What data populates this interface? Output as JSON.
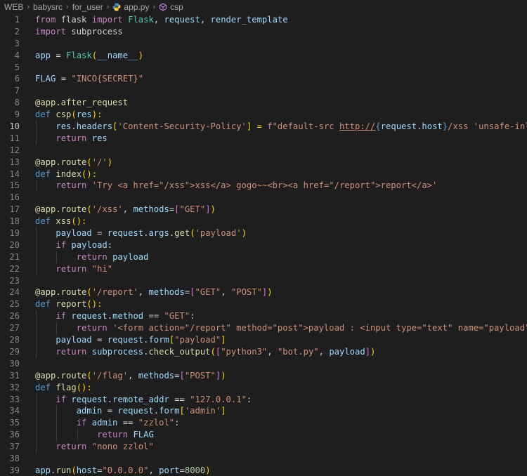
{
  "breadcrumb": {
    "items": [
      "WEB",
      "babysrc",
      "for_user",
      "app.py",
      "csp"
    ]
  },
  "editor": {
    "current_line": 10,
    "lines": [
      {
        "n": "1"
      },
      {
        "n": "2"
      },
      {
        "n": "3"
      },
      {
        "n": "4"
      },
      {
        "n": "5"
      },
      {
        "n": "6"
      },
      {
        "n": "7"
      },
      {
        "n": "8"
      },
      {
        "n": "9"
      },
      {
        "n": "10"
      },
      {
        "n": "11"
      },
      {
        "n": "12"
      },
      {
        "n": "13"
      },
      {
        "n": "14"
      },
      {
        "n": "15"
      },
      {
        "n": "16"
      },
      {
        "n": "17"
      },
      {
        "n": "18"
      },
      {
        "n": "19"
      },
      {
        "n": "20"
      },
      {
        "n": "21"
      },
      {
        "n": "22"
      },
      {
        "n": "23"
      },
      {
        "n": "24"
      },
      {
        "n": "25"
      },
      {
        "n": "26"
      },
      {
        "n": "27"
      },
      {
        "n": "28"
      },
      {
        "n": "29"
      },
      {
        "n": "30"
      },
      {
        "n": "31"
      },
      {
        "n": "32"
      },
      {
        "n": "33"
      },
      {
        "n": "34"
      },
      {
        "n": "35"
      },
      {
        "n": "36"
      },
      {
        "n": "37"
      },
      {
        "n": "38"
      },
      {
        "n": "39"
      }
    ],
    "tokens": {
      "l1": [
        "from",
        " flask ",
        "import",
        " ",
        "Flask",
        ", ",
        "request",
        ", ",
        "render_template"
      ],
      "l2": [
        "import",
        " subprocess"
      ],
      "l4": [
        "app",
        " = ",
        "Flask",
        "(",
        "__name__",
        ")"
      ],
      "l6": [
        "FLAG",
        " = ",
        "\"INCO{SECRET}\""
      ],
      "l8": [
        "@app.after_request"
      ],
      "l9": [
        "def",
        " ",
        "csp",
        "(",
        "res",
        "):"
      ],
      "l10": [
        "    ",
        "res",
        ".",
        "headers",
        "[",
        "'Content-Security-Policy'",
        "] = ",
        "f\"default-src ",
        "http://",
        "{",
        "request",
        ".",
        "host",
        "}",
        "/xss 'unsafe-inline';\""
      ],
      "l11": [
        "    ",
        "return",
        " ",
        "res"
      ],
      "l13": [
        "@app.route",
        "(",
        "'/'",
        ")"
      ],
      "l14": [
        "def",
        " ",
        "index",
        "():"
      ],
      "l15": [
        "    ",
        "return",
        " ",
        "'Try <a href=\"/xss\">xss</a> gogo~~<br><a href=\"/report\">report</a>'"
      ],
      "l17": [
        "@app.route",
        "(",
        "'/xss'",
        ", ",
        "methods",
        "=",
        "[",
        "\"GET\"",
        "]",
        ")"
      ],
      "l18": [
        "def",
        " ",
        "xss",
        "():"
      ],
      "l19": [
        "    ",
        "payload",
        " = ",
        "request",
        ".",
        "args",
        ".",
        "get",
        "(",
        "'payload'",
        ")"
      ],
      "l20": [
        "    ",
        "if",
        " ",
        "payload",
        ":"
      ],
      "l21": [
        "        ",
        "return",
        " ",
        "payload"
      ],
      "l22": [
        "    ",
        "return",
        " ",
        "\"hi\""
      ],
      "l24": [
        "@app.route",
        "(",
        "'/report'",
        ", ",
        "methods",
        "=",
        "[",
        "\"GET\"",
        ", ",
        "\"POST\"",
        "]",
        ")"
      ],
      "l25": [
        "def",
        " ",
        "report",
        "():"
      ],
      "l26": [
        "    ",
        "if",
        " ",
        "request",
        ".",
        "method",
        " == ",
        "\"GET\"",
        ":"
      ],
      "l27": [
        "        ",
        "return",
        " ",
        "'<form action=\"/report\" method=\"post\">payload : <input type=\"text\" name=\"payload\"><input type=\"sub"
      ],
      "l28": [
        "    ",
        "payload",
        " = ",
        "request",
        ".",
        "form",
        "[",
        "\"payload\"",
        "]"
      ],
      "l29": [
        "    ",
        "return",
        " ",
        "subprocess",
        ".",
        "check_output",
        "(",
        "[",
        "\"python3\"",
        ", ",
        "\"bot.py\"",
        ", ",
        "payload",
        "]",
        ")"
      ],
      "l31": [
        "@app.route",
        "(",
        "'/flag'",
        ", ",
        "methods",
        "=",
        "[",
        "\"POST\"",
        "]",
        ")"
      ],
      "l32": [
        "def",
        " ",
        "flag",
        "():"
      ],
      "l33": [
        "    ",
        "if",
        " ",
        "request",
        ".",
        "remote_addr",
        " == ",
        "\"127.0.0.1\"",
        ":"
      ],
      "l34": [
        "        ",
        "admin",
        " = ",
        "request",
        ".",
        "form",
        "[",
        "'admin'",
        "]"
      ],
      "l35": [
        "        ",
        "if",
        " ",
        "admin",
        " == ",
        "\"zzlol\"",
        ":"
      ],
      "l36": [
        "            ",
        "return",
        " ",
        "FLAG"
      ],
      "l37": [
        "    ",
        "return",
        " ",
        "\"nono zzlol\""
      ],
      "l39": [
        "app",
        ".",
        "run",
        "(",
        "host",
        "=",
        "\"0.0.0.0\"",
        ", ",
        "port",
        "=",
        "8000",
        ")"
      ]
    }
  },
  "colors": {
    "background": "#1e1e1e",
    "keyword_control": "#c586c0",
    "keyword_def": "#569cd6",
    "function": "#dcdcaa",
    "variable": "#9cdcfe",
    "class": "#4ec9b0",
    "string": "#ce9178",
    "number": "#b5cea8"
  }
}
